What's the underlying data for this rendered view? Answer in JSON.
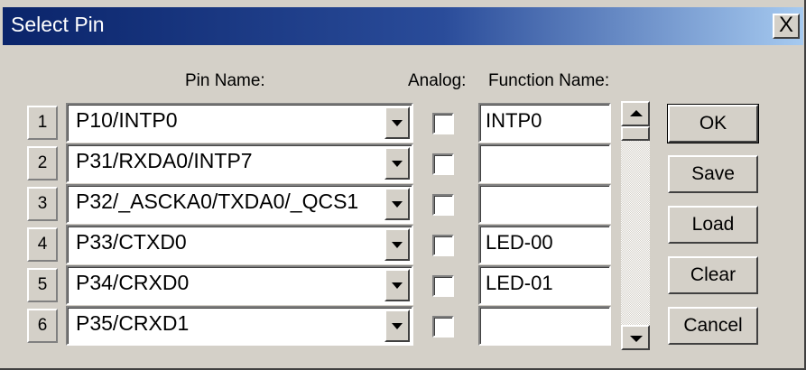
{
  "window": {
    "title": "Select Pin",
    "close_label": "X"
  },
  "headers": {
    "pin_name": "Pin Name:",
    "analog": "Analog:",
    "function_name": "Function Name:"
  },
  "rows": [
    {
      "number": "1",
      "pin": "P10/INTP0",
      "analog_checked": false,
      "function": "INTP0"
    },
    {
      "number": "2",
      "pin": "P31/RXDA0/INTP7",
      "analog_checked": false,
      "function": ""
    },
    {
      "number": "3",
      "pin": "P32/_ASCKA0/TXDA0/_QCS1",
      "analog_checked": false,
      "function": ""
    },
    {
      "number": "4",
      "pin": "P33/CTXD0",
      "analog_checked": false,
      "function": "LED-00"
    },
    {
      "number": "5",
      "pin": "P34/CRXD0",
      "analog_checked": false,
      "function": "LED-01"
    },
    {
      "number": "6",
      "pin": "P35/CRXD1",
      "analog_checked": false,
      "function": ""
    }
  ],
  "buttons": {
    "ok": "OK",
    "save": "Save",
    "load": "Load",
    "clear": "Clear",
    "cancel": "Cancel"
  },
  "colors": {
    "titlebar_start": "#0a246a",
    "titlebar_end": "#a6caf0",
    "dialog_bg": "#d4d0c8"
  }
}
